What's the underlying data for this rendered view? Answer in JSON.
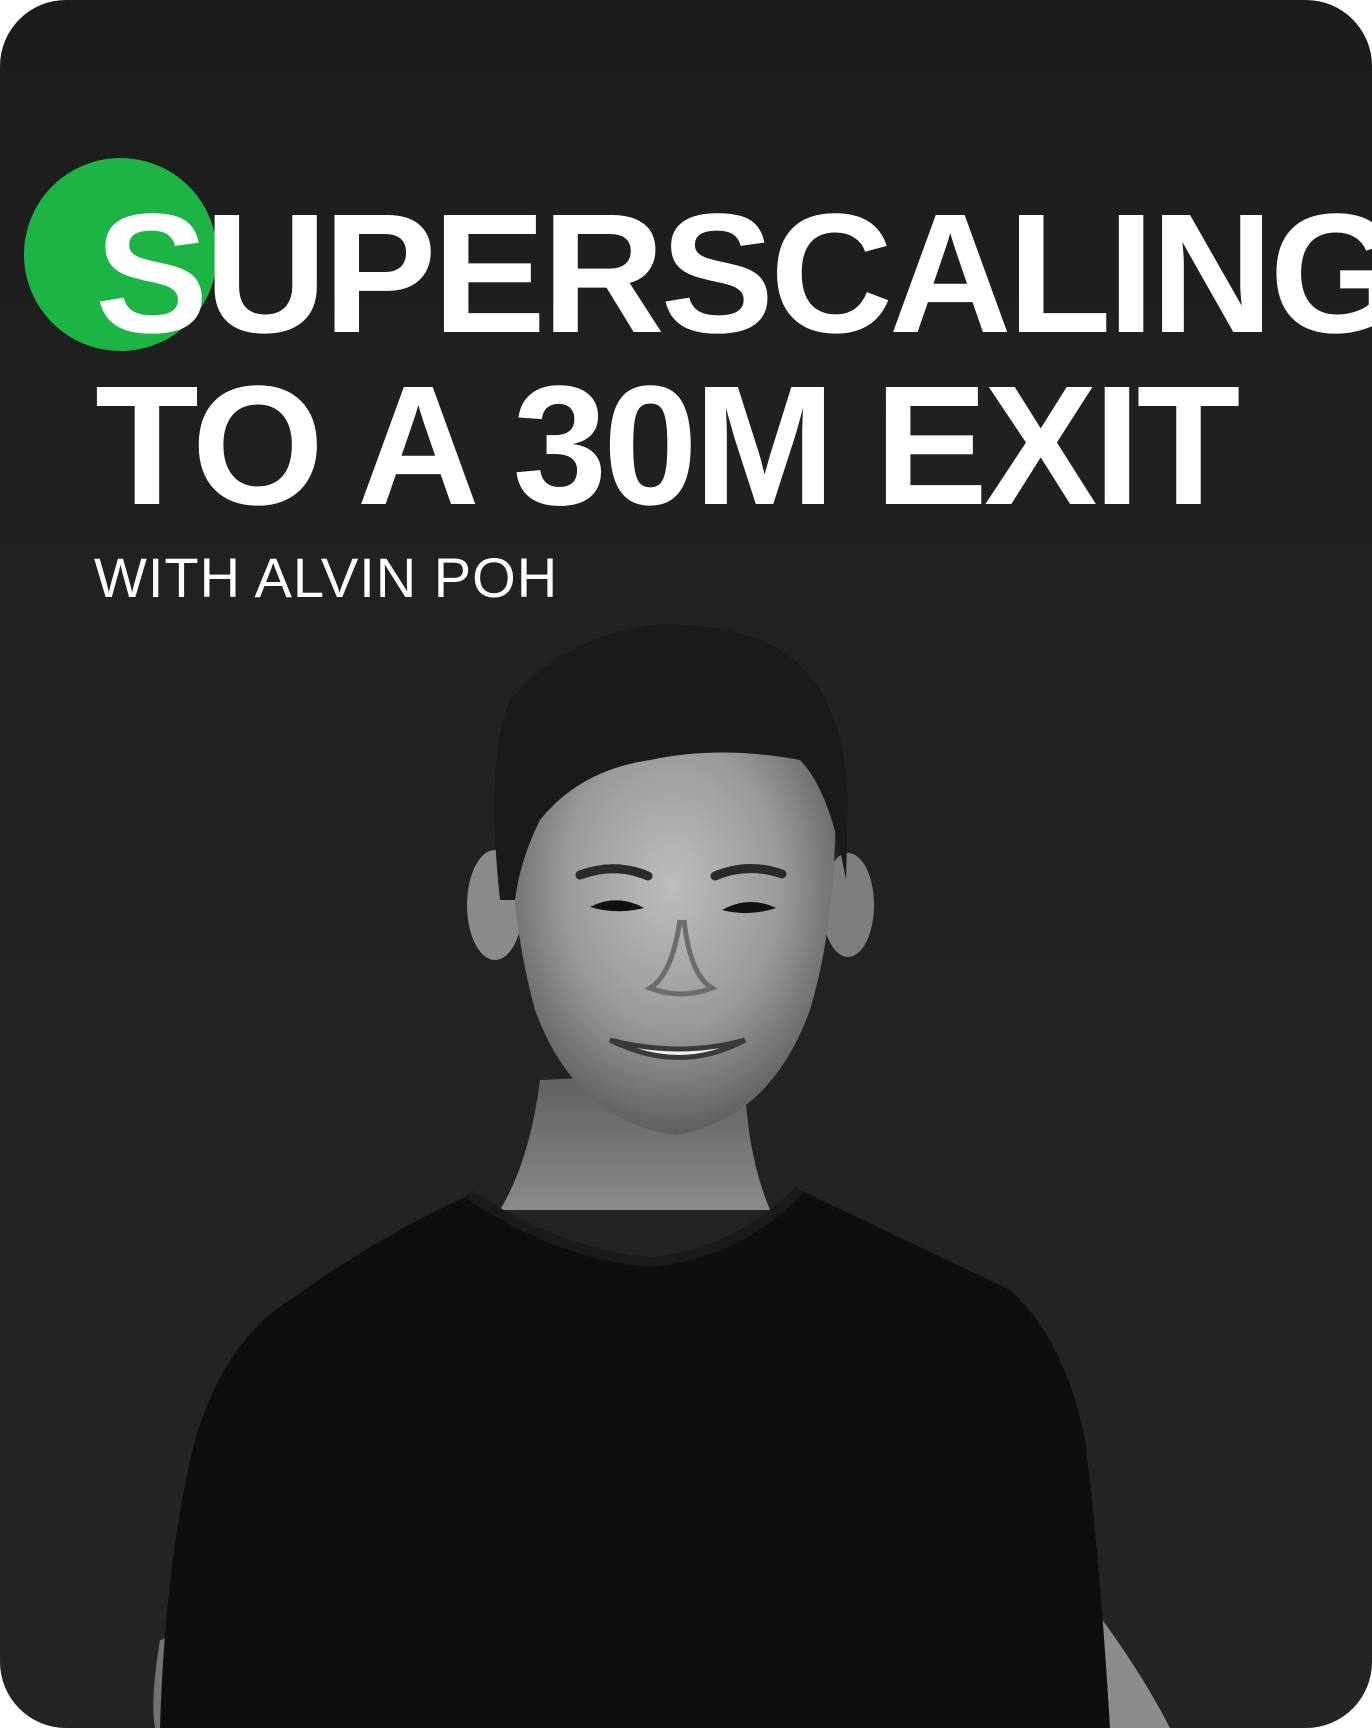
{
  "title": {
    "line1": "SUPERSCALING",
    "line2": "TO A 30M EXIT"
  },
  "subtitle": "WITH ALVIN POH",
  "colors": {
    "accent": "#1db446",
    "background": "#222222",
    "text": "#ffffff"
  },
  "portrait": {
    "icon": "person-portrait-icon"
  }
}
